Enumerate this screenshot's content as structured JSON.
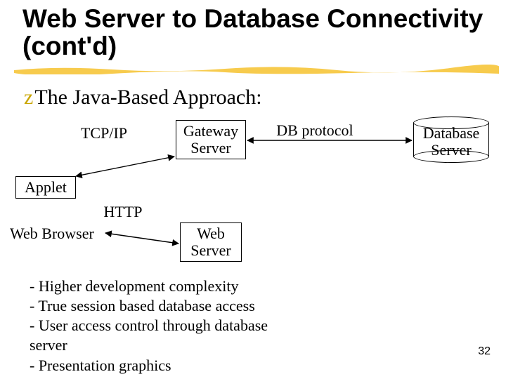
{
  "title": "Web Server to Database Connectivity (cont'd)",
  "subhead": "The Java-Based Approach:",
  "labels": {
    "tcpip": "TCP/IP",
    "dbproto": "DB protocol",
    "http": "HTTP",
    "webbrowser": "Web Browser"
  },
  "boxes": {
    "gateway": "Gateway\nServer",
    "applet": "Applet",
    "webserver": "Web\nServer",
    "db": "Database\nServer"
  },
  "bullets": [
    "- Higher development complexity",
    "- True session based database access",
    "- User access control through database",
    "server",
    "- Presentation graphics"
  ],
  "page": "32"
}
